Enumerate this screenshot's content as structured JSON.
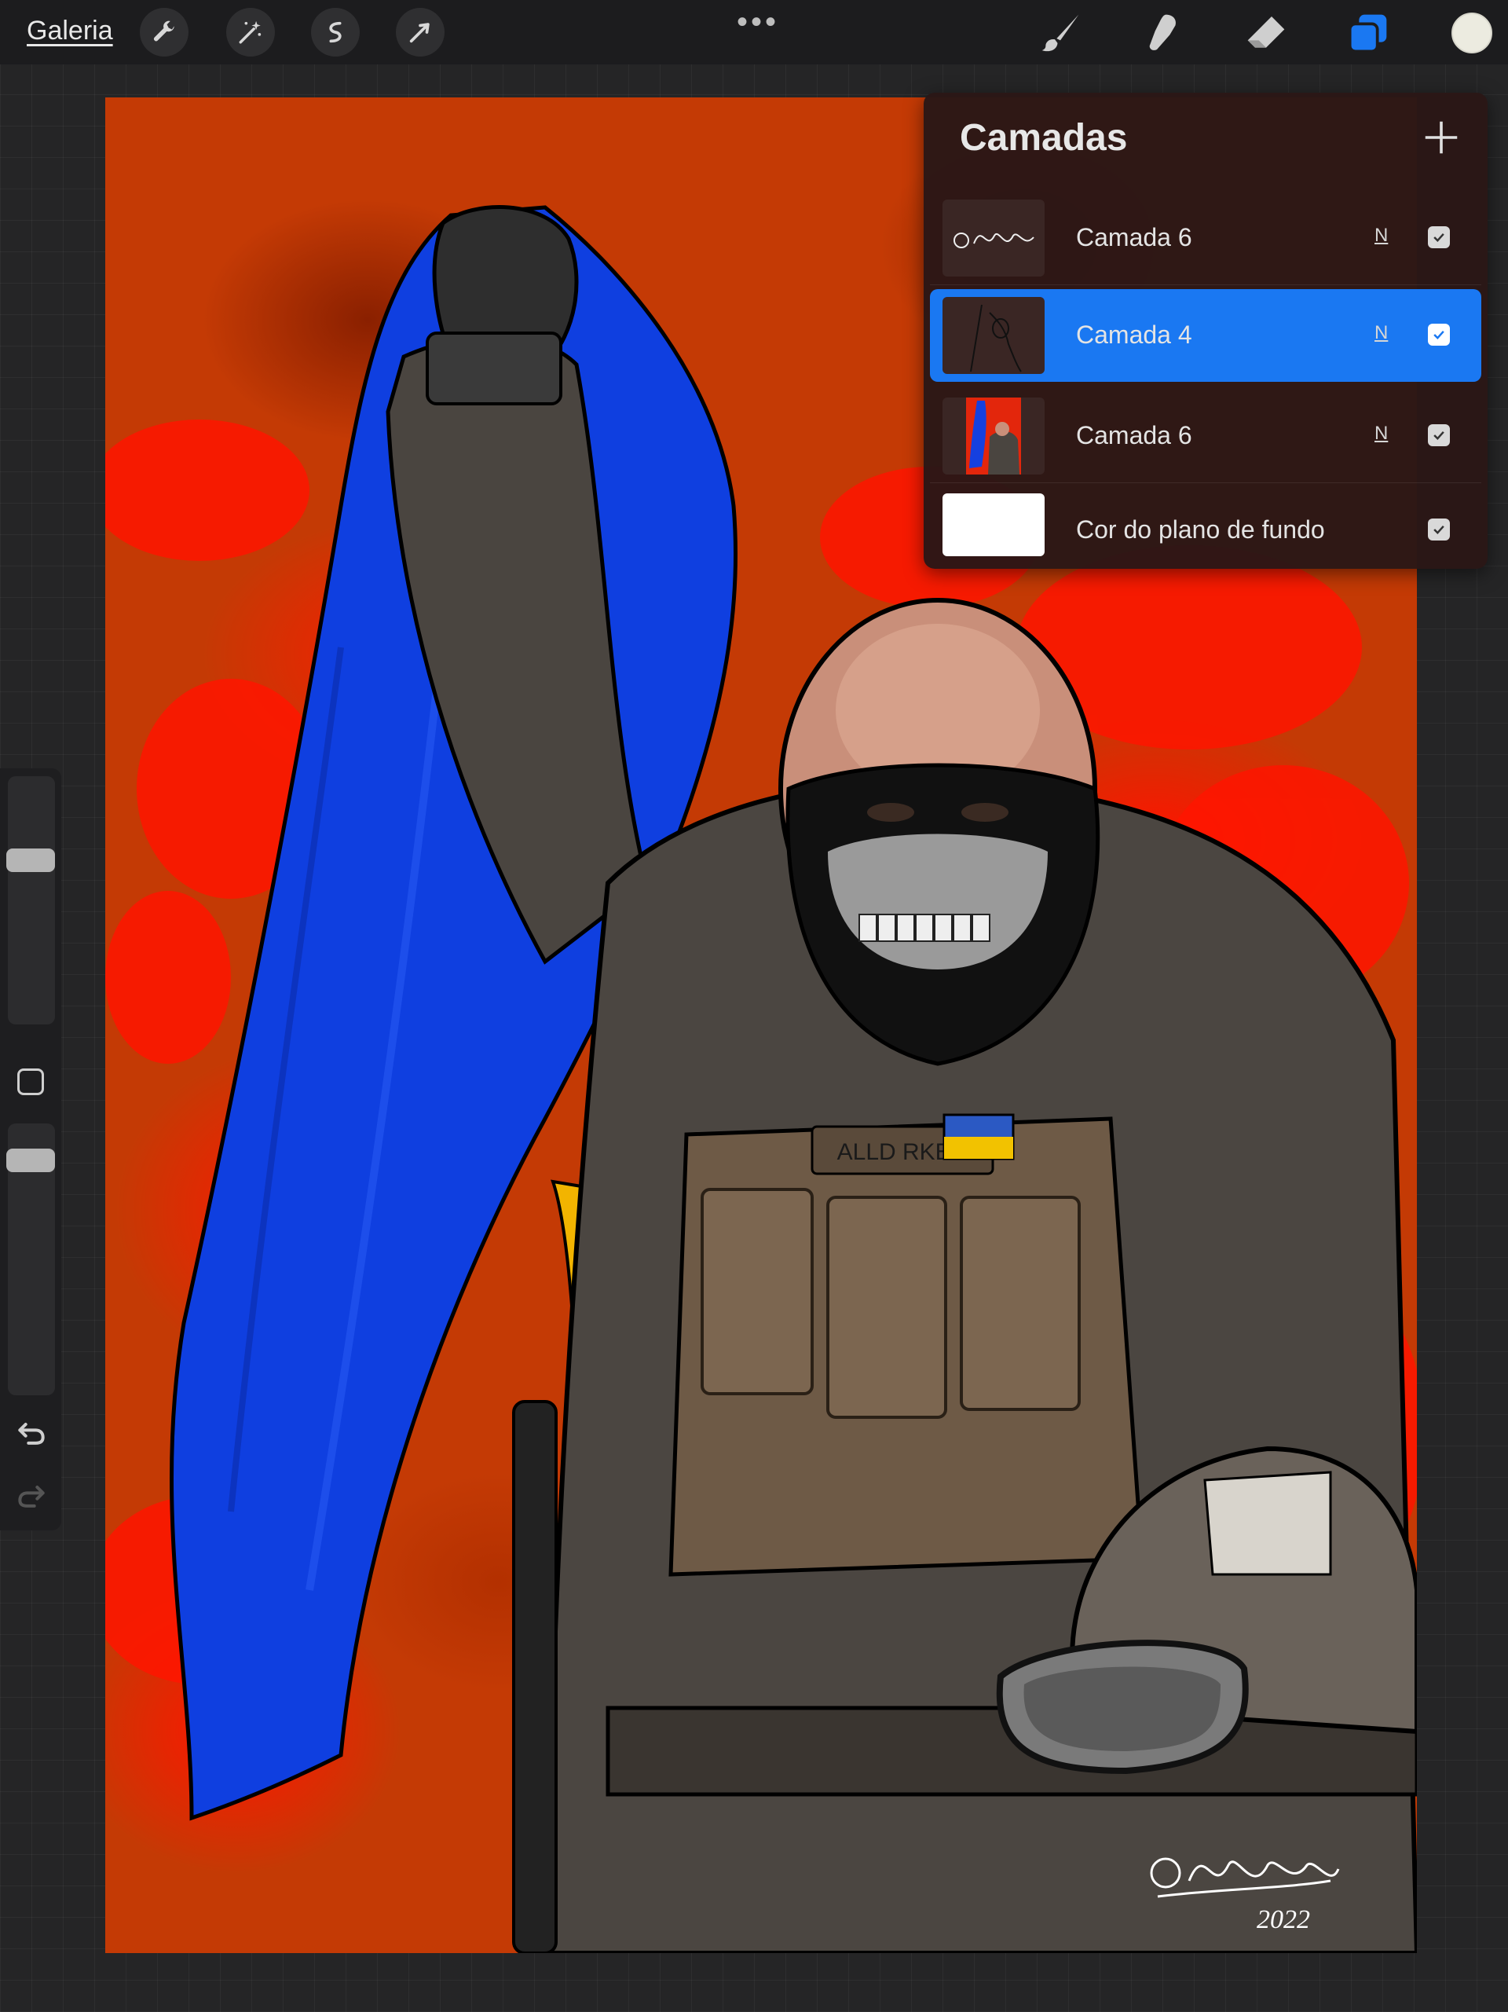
{
  "topbar": {
    "gallery_label": "Galeria",
    "tools_left": [
      "wrench-icon",
      "magic-wand-icon",
      "selection-icon",
      "transform-arrow-icon"
    ],
    "more_label": "•••",
    "tools_right": [
      "brush-icon",
      "smudge-icon",
      "eraser-icon",
      "layers-icon"
    ],
    "accent_color": "#1a78f2",
    "current_color": "#ecebe0"
  },
  "layers": {
    "title": "Camadas",
    "add_icon": "plus-icon",
    "items": [
      {
        "name": "Camada 6",
        "blend": "N",
        "visible": true,
        "active": false,
        "thumb": "signature"
      },
      {
        "name": "Camada 4",
        "blend": "N",
        "visible": true,
        "active": true,
        "thumb": "lineart"
      },
      {
        "name": "Camada 6",
        "blend": "N",
        "visible": true,
        "active": false,
        "thumb": "artwork"
      },
      {
        "name": "Cor do plano de fundo",
        "blend": "",
        "visible": true,
        "active": false,
        "thumb": "white"
      }
    ]
  },
  "sidebar": {
    "brush_size_level": 0.68,
    "opacity_level": 0.9,
    "undo_icon": "undo-icon",
    "redo_icon": "redo-icon"
  },
  "artwork": {
    "signature_year": "2022",
    "patch_text": "ALLD RKEH"
  }
}
